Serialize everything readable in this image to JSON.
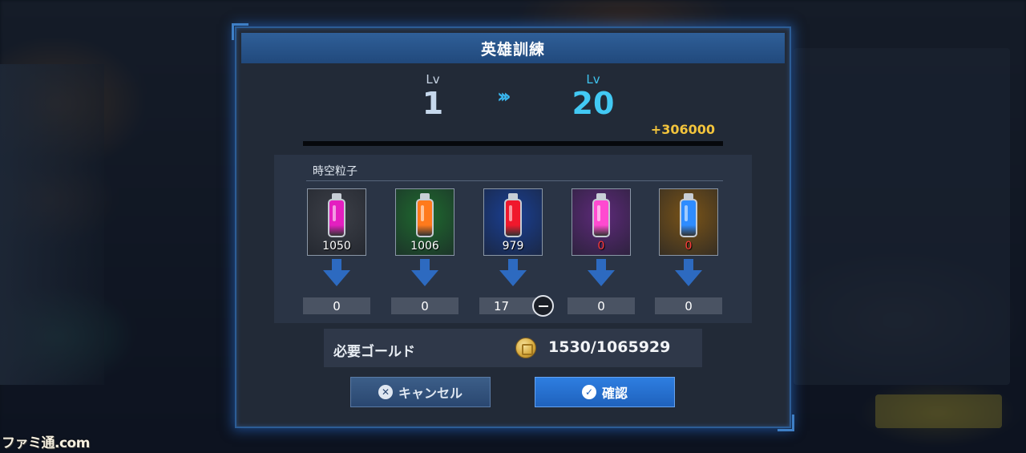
{
  "dialog": {
    "title": "英雄訓練",
    "level": {
      "label_from": "Lv",
      "from": "1",
      "label_to": "Lv",
      "to": "20",
      "exp_gain": "+306000"
    },
    "particles": {
      "title": "時空粒子",
      "items": [
        {
          "count": "1050",
          "color": "#e41fc0",
          "bg": "#3d4048",
          "selected": "0"
        },
        {
          "count": "1006",
          "color": "#ff7a1c",
          "bg": "#1f6b2f",
          "selected": "0"
        },
        {
          "count": "979",
          "color": "#f0182c",
          "bg": "#1a3f94",
          "selected": "17"
        },
        {
          "count": "0",
          "color": "#ff4ad0",
          "bg": "#5e2a7a",
          "selected": "0"
        },
        {
          "count": "0",
          "color": "#2e8cff",
          "bg": "#7a5418",
          "selected": "0"
        }
      ]
    },
    "gold": {
      "label": "必要ゴールド",
      "value": "1530/1065929"
    },
    "buttons": {
      "cancel": "キャンセル",
      "confirm": "確認"
    }
  },
  "watermark": "ファミ通.com",
  "colors": {
    "accent": "#42c9f4",
    "exp": "#f3c43c",
    "title_bar": "#2f5f98",
    "confirm": "#2e7ee0"
  }
}
